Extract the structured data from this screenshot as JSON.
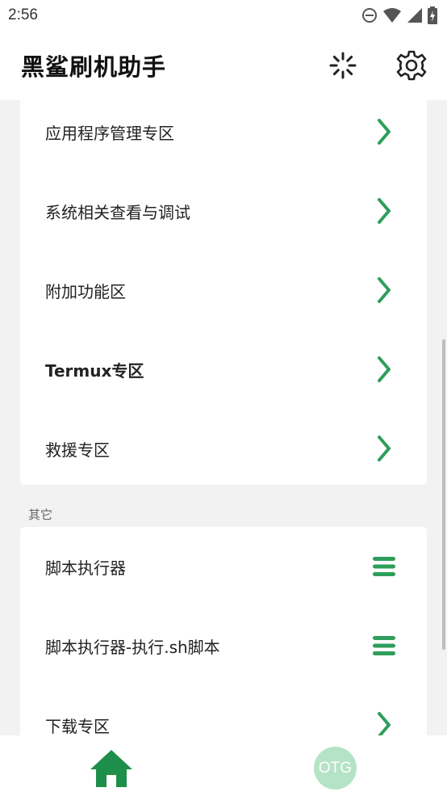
{
  "status_bar": {
    "time": "2:56",
    "icons": [
      "do-not-disturb-icon",
      "wifi-icon",
      "signal-icon",
      "battery-charging-icon"
    ]
  },
  "app_bar": {
    "title": "黑鲨刷机助手",
    "actions": [
      "loading-icon",
      "settings-icon"
    ]
  },
  "main_card": {
    "items": [
      {
        "label": "应用程序管理专区",
        "icon": "chevron-right-icon"
      },
      {
        "label": "系统相关查看与调试",
        "icon": "chevron-right-icon"
      },
      {
        "label": "附加功能区",
        "icon": "chevron-right-icon"
      },
      {
        "label": "Termux专区",
        "icon": "chevron-right-icon"
      },
      {
        "label": "救援专区",
        "icon": "chevron-right-icon"
      }
    ]
  },
  "other_section": {
    "header": "其它",
    "items": [
      {
        "label": "脚本执行器",
        "icon": "menu-icon"
      },
      {
        "label": "脚本执行器-执行.sh脚本",
        "icon": "menu-icon"
      },
      {
        "label": "下载专区",
        "icon": "chevron-right-icon"
      }
    ]
  },
  "bottom_nav": {
    "home_icon": "home-icon",
    "otg_label": "OTG"
  },
  "colors": {
    "accent": "#2e9e5b",
    "otg_bg": "#b5e3c6",
    "background": "#f2f2f2"
  }
}
